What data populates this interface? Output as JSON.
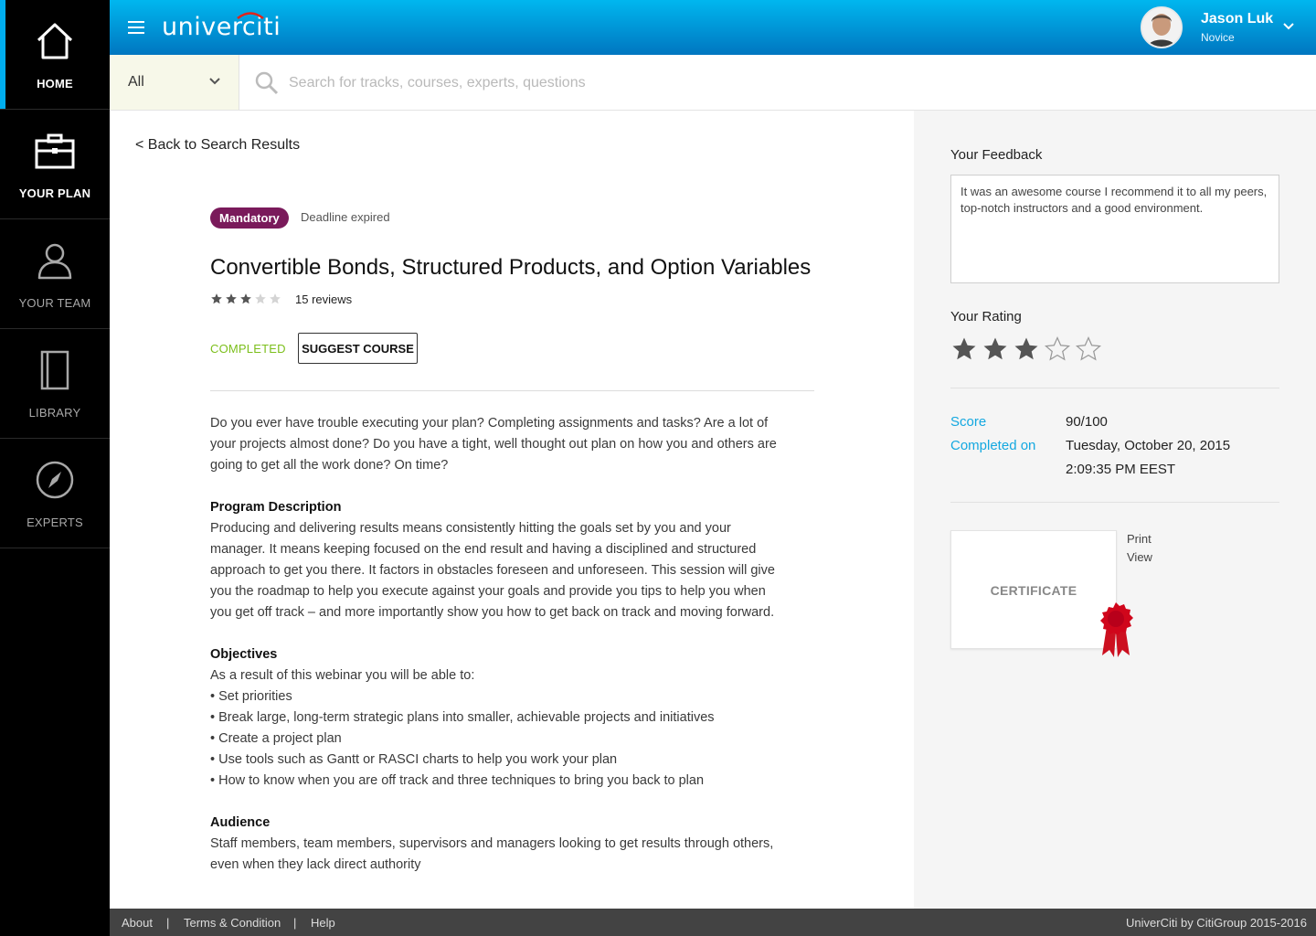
{
  "sidebar": {
    "items": [
      {
        "label": "HOME",
        "icon": "home-icon"
      },
      {
        "label": "YOUR PLAN",
        "icon": "briefcase-icon"
      },
      {
        "label": "YOUR TEAM",
        "icon": "user-icon"
      },
      {
        "label": "LIBRARY",
        "icon": "book-icon"
      },
      {
        "label": "EXPERTS",
        "icon": "compass-icon"
      }
    ]
  },
  "header": {
    "logo": "univercit",
    "logo_i": "i",
    "user": {
      "name": "Jason Luk",
      "level": "Novice"
    }
  },
  "search": {
    "filter_value": "All",
    "placeholder": "Search for tracks, courses, experts, questions"
  },
  "main": {
    "back_link": "< Back to Search Results",
    "badge": "Mandatory",
    "deadline": "Deadline expired",
    "title": "Convertible Bonds, Structured Products, and Option Variables",
    "rating": 3,
    "rating_max": 5,
    "reviews": "15 reviews",
    "status": "COMPLETED",
    "suggest_button": "SUGGEST COURSE",
    "intro": "Do you ever have trouble executing your plan? Completing assignments and tasks? Are a lot of your projects almost done? Do you have a tight, well thought out plan on how you and others are going to get all the work done? On time?",
    "program_heading": "Program Description",
    "program_text": "Producing and delivering results means consistently hitting the goals set by you and your manager. It means keeping focused on the end result and having a disciplined and structured approach to get you there. It factors in obstacles foreseen and unforeseen. This session will give you the roadmap to help you execute against your goals and provide you tips to help you when you get off track – and more importantly show you how to get back on track and moving forward.",
    "objectives_heading": "Objectives",
    "objectives_intro": "As a result of this webinar you will be able to:",
    "objectives": [
      "• Set priorities",
      "• Break large, long-term strategic plans into smaller, achievable projects and initiatives",
      "• Create a project plan",
      "• Use tools such as Gantt or RASCI charts to help you work your plan",
      "• How to know when you are off track and three techniques to bring you back to plan"
    ],
    "audience_heading": "Audience",
    "audience_text": "Staff members, team members, supervisors and managers looking to get results through others, even when they lack direct authority"
  },
  "panel": {
    "feedback_label": "Your Feedback",
    "feedback_text": "It was an awesome course I recommend it to all my peers, top-notch instructors and a good environment.",
    "rating_label": "Your Rating",
    "user_rating": 3,
    "score_label": "Score",
    "score_value": "90/100",
    "completed_label": "Completed on",
    "completed_date": "Tuesday, October 20, 2015",
    "completed_time": "2:09:35 PM EEST",
    "certificate_label": "CERTIFICATE",
    "print_link": "Print",
    "view_link": "View"
  },
  "footer": {
    "about": "About",
    "separator": "|",
    "terms": "Terms & Condition",
    "help": "Help",
    "copyright": "UniverCiti by CitiGroup 2015-2016"
  },
  "colors": {
    "accent": "#00aeef",
    "header_gradient_top": "#00b7ef",
    "header_gradient_bottom": "#0076c0",
    "badge": "#7a1a5b",
    "completed": "#7cbf1c",
    "link_blue": "#14a8e0",
    "footer": "#434343"
  }
}
